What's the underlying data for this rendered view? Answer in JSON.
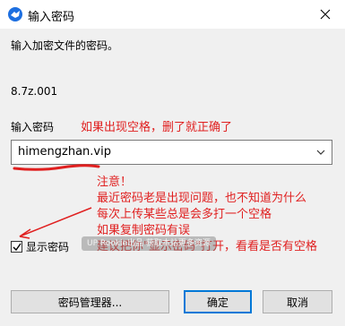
{
  "window": {
    "title": "输入密码"
  },
  "dialog": {
    "prompt": "输入加密文件的密码。",
    "filename": "8.7z.001",
    "password_label": "输入密码",
    "password_value": "himengzhan.vip",
    "show_password_label": "显示密码",
    "show_password_checked": true
  },
  "annotations": {
    "note_space": "如果出现空格，删了就正确了",
    "notes": [
      "注意！",
      "最近密码老是出现问题，也不知道为什么",
      "每次上传某些总是会多打一个空格",
      "如果复制密码有误",
      "建议把你\"显示密码\"打开，看看是否有空格"
    ],
    "accent_color": "#e02020"
  },
  "watermark": {
    "text": "UP Rookie出品 获取本站更多资源"
  },
  "buttons": {
    "manager": "密码管理器...",
    "ok": "确定",
    "cancel": "取消"
  },
  "icons": {
    "app": "app-icon",
    "close": "close-icon",
    "dropdown": "chevron-down-icon",
    "check": "checkmark-icon"
  }
}
